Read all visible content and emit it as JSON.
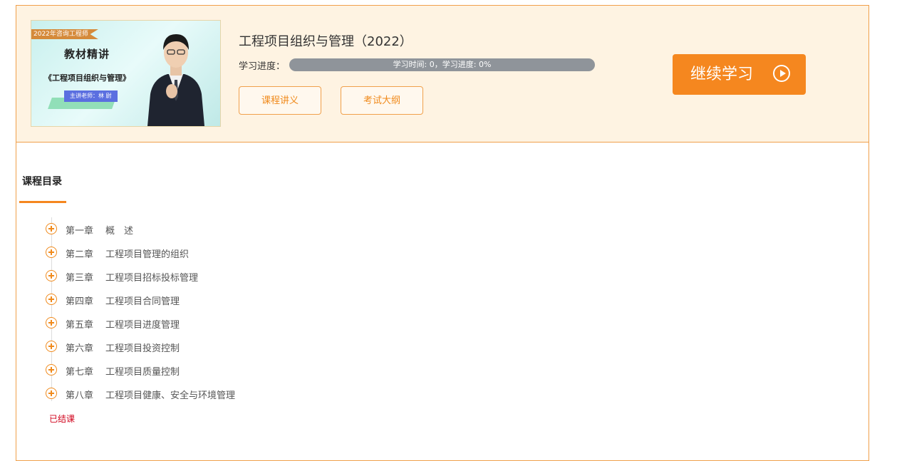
{
  "thumbnail": {
    "ribbon": "2022年咨询工程师",
    "heading": "教材精讲",
    "subtitle": "《工程项目组织与管理》",
    "teacher": "主讲老师：林 尉"
  },
  "course": {
    "title": "工程项目组织与管理（2022）",
    "progress_label": "学习进度：",
    "progress_text": "学习时间: 0，学习进度: 0%",
    "progress_value": 0,
    "handout_button": "课程讲义",
    "syllabus_button": "考试大纲",
    "continue_button": "继续学习"
  },
  "catalog": {
    "title": "课程目录",
    "chapters": [
      {
        "num": "第一章",
        "name": "概　述"
      },
      {
        "num": "第二章",
        "name": "工程项目管理的组织"
      },
      {
        "num": "第三章",
        "name": "工程项目招标投标管理"
      },
      {
        "num": "第四章",
        "name": "工程项目合同管理"
      },
      {
        "num": "第五章",
        "name": "工程项目进度管理"
      },
      {
        "num": "第六章",
        "name": "工程项目投资控制"
      },
      {
        "num": "第七章",
        "name": "工程项目质量控制"
      },
      {
        "num": "第八章",
        "name": "工程项目健康、安全与环境管理"
      }
    ],
    "status": "已结课"
  },
  "colors": {
    "accent": "#f5871f",
    "header_bg": "#fef3e2",
    "status_red": "#d0021b",
    "progress_track": "#8f949a"
  }
}
